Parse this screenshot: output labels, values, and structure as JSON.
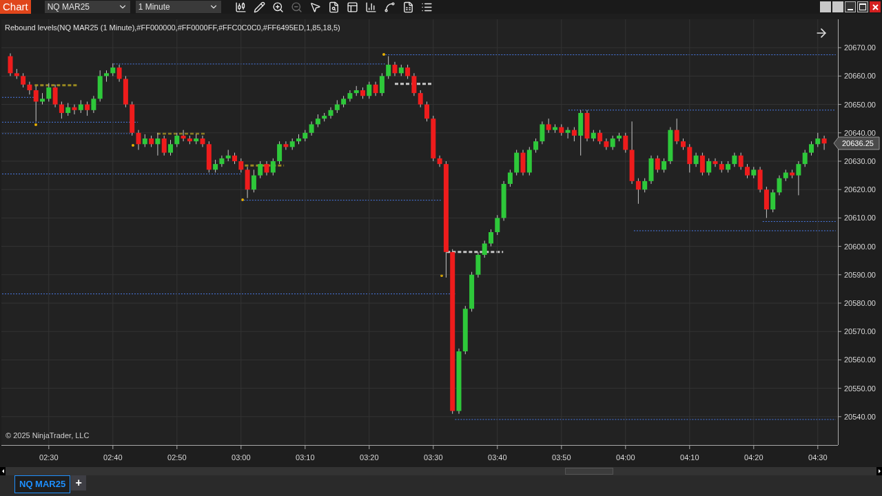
{
  "toolbar": {
    "title_tab": "Chart",
    "instrument": "NQ MAR25",
    "interval": "1 Minute"
  },
  "chart": {
    "indicator_label": "Rebound levels(NQ MAR25 (1 Minute),#FF000000,#FF0000FF,#FFC0C0C0,#FF6495ED,1,85,18,5)",
    "last_price": "20636.25",
    "chart_data": {
      "type": "candlestick",
      "grid": true,
      "categories": [
        null,
        null,
        null,
        null,
        null,
        null,
        "02:30",
        null,
        null,
        null,
        null,
        null,
        null,
        null,
        null,
        null,
        "02:40",
        null,
        null,
        null,
        null,
        null,
        null,
        null,
        null,
        null,
        "02:50",
        null,
        null,
        null,
        null,
        null,
        null,
        null,
        null,
        null,
        "03:00",
        null,
        null,
        null,
        null,
        null,
        null,
        null,
        null,
        null,
        "03:10",
        null,
        null,
        null,
        null,
        null,
        null,
        null,
        null,
        null,
        "03:20",
        null,
        null,
        null,
        null,
        null,
        null,
        null,
        null,
        null,
        "03:30",
        null,
        null,
        null,
        null,
        null,
        null,
        null,
        null,
        null,
        "03:40",
        null,
        null,
        null,
        null,
        null,
        null,
        null,
        null,
        null,
        "03:50",
        null,
        null,
        null,
        null,
        null,
        null,
        null,
        null,
        null,
        "04:00",
        null,
        null,
        null,
        null,
        null,
        null,
        null,
        null,
        null,
        "04:10",
        null,
        null,
        null,
        null,
        null,
        null,
        null,
        null,
        null,
        "04:20",
        null,
        null,
        null,
        null,
        null,
        null,
        null,
        null,
        null,
        "04:30",
        null
      ],
      "ohlc": [
        [
          20667,
          20668,
          20660,
          20661
        ],
        [
          20661,
          20662.5,
          20659,
          20660
        ],
        [
          20660,
          20661,
          20656,
          20657
        ],
        [
          20657,
          20658,
          20653.5,
          20655
        ],
        [
          20655,
          20656.5,
          20644,
          20651
        ],
        [
          20651,
          20654,
          20650,
          20652
        ],
        [
          20652,
          20657.5,
          20651,
          20656
        ],
        [
          20656,
          20657,
          20649,
          20650
        ],
        [
          20650,
          20651,
          20645,
          20647
        ],
        [
          20647,
          20650.5,
          20646,
          20649
        ],
        [
          20649,
          20650,
          20646.5,
          20648
        ],
        [
          20648,
          20651.5,
          20647,
          20650
        ],
        [
          20650,
          20651,
          20646,
          20648
        ],
        [
          20648,
          20653,
          20647,
          20652
        ],
        [
          20652,
          20662,
          20651,
          20660
        ],
        [
          20660,
          20662,
          20658,
          20661
        ],
        [
          20661,
          20664.5,
          20660,
          20663
        ],
        [
          20663,
          20664,
          20658,
          20659
        ],
        [
          20659,
          20660,
          20649,
          20650
        ],
        [
          20650,
          20651,
          20639,
          20640
        ],
        [
          20640,
          20641,
          20634,
          20636
        ],
        [
          20636,
          20639.5,
          20635,
          20638
        ],
        [
          20638,
          20639,
          20635,
          20636
        ],
        [
          20636,
          20640,
          20632,
          20638
        ],
        [
          20638,
          20639,
          20632,
          20633
        ],
        [
          20633,
          20637.5,
          20632,
          20636
        ],
        [
          20636,
          20640,
          20635,
          20639
        ],
        [
          20639,
          20641,
          20637,
          20638
        ],
        [
          20638,
          20639,
          20636,
          20637
        ],
        [
          20637,
          20639.5,
          20636,
          20638
        ],
        [
          20638,
          20639,
          20635,
          20636
        ],
        [
          20636,
          20637,
          20626,
          20627
        ],
        [
          20627,
          20630.5,
          20626,
          20629
        ],
        [
          20629,
          20632,
          20628,
          20631
        ],
        [
          20631,
          20634,
          20630,
          20632
        ],
        [
          20632,
          20633,
          20629,
          20630
        ],
        [
          20630,
          20631,
          20626,
          20627
        ],
        [
          20627,
          20628,
          20617,
          20620
        ],
        [
          20620,
          20627,
          20619,
          20625
        ],
        [
          20625,
          20630,
          20624,
          20629
        ],
        [
          20629,
          20630,
          20625,
          20626
        ],
        [
          20626,
          20631,
          20625,
          20630
        ],
        [
          20630,
          20637,
          20629,
          20636
        ],
        [
          20636,
          20637,
          20634,
          20635
        ],
        [
          20635,
          20638,
          20634,
          20637
        ],
        [
          20637,
          20639.5,
          20636,
          20638
        ],
        [
          20638,
          20641,
          20637,
          20640
        ],
        [
          20640,
          20644,
          20639,
          20643
        ],
        [
          20643,
          20646.5,
          20642,
          20645
        ],
        [
          20645,
          20647,
          20644,
          20646
        ],
        [
          20646,
          20649,
          20645,
          20648
        ],
        [
          20648,
          20651.5,
          20647,
          20650
        ],
        [
          20650,
          20653,
          20649,
          20652
        ],
        [
          20652,
          20655,
          20651,
          20654
        ],
        [
          20654,
          20656.5,
          20653,
          20655
        ],
        [
          20655,
          20656,
          20652,
          20653
        ],
        [
          20653,
          20658,
          20652,
          20657
        ],
        [
          20657,
          20658,
          20653,
          20654
        ],
        [
          20654,
          20661,
          20653,
          20660
        ],
        [
          20660,
          20667,
          20659,
          20664
        ],
        [
          20664,
          20665,
          20660,
          20661
        ],
        [
          20661,
          20664,
          20660,
          20663
        ],
        [
          20663,
          20664,
          20659,
          20660
        ],
        [
          20660,
          20661,
          20653,
          20654
        ],
        [
          20654,
          20655,
          20649,
          20650
        ],
        [
          20650,
          20651,
          20644,
          20645
        ],
        [
          20645,
          20646,
          20630,
          20631
        ],
        [
          20631,
          20632,
          20628,
          20629
        ],
        [
          20629,
          20630,
          20589,
          20598
        ],
        [
          20598,
          20599,
          20541,
          20542
        ],
        [
          20542,
          20564,
          20541,
          20563
        ],
        [
          20563,
          20579,
          20562,
          20578
        ],
        [
          20578,
          20591,
          20577,
          20590
        ],
        [
          20590,
          20598,
          20589,
          20597
        ],
        [
          20597,
          20602,
          20596,
          20601
        ],
        [
          20601,
          20606,
          20600,
          20605
        ],
        [
          20605,
          20611,
          20604,
          20610
        ],
        [
          20610,
          20623,
          20609,
          20622
        ],
        [
          20622,
          20627,
          20621,
          20626
        ],
        [
          20626,
          20634,
          20625,
          20633
        ],
        [
          20633,
          20634,
          20625,
          20626
        ],
        [
          20626,
          20635,
          20625,
          20634
        ],
        [
          20634,
          20638,
          20633,
          20637
        ],
        [
          20637,
          20644,
          20636,
          20643
        ],
        [
          20643,
          20645,
          20640,
          20641
        ],
        [
          20641,
          20643,
          20640,
          20642
        ],
        [
          20642,
          20643,
          20639,
          20640
        ],
        [
          20640,
          20642,
          20638,
          20641
        ],
        [
          20641,
          20642,
          20637,
          20639
        ],
        [
          20639,
          20648,
          20632,
          20647
        ],
        [
          20647,
          20648,
          20637,
          20638
        ],
        [
          20638,
          20641,
          20637,
          20640
        ],
        [
          20640,
          20641,
          20636,
          20637
        ],
        [
          20637,
          20638,
          20634,
          20635
        ],
        [
          20635,
          20639,
          20634,
          20638
        ],
        [
          20638,
          20640,
          20637,
          20639
        ],
        [
          20639,
          20640,
          20633,
          20634
        ],
        [
          20634,
          20644,
          20622,
          20623
        ],
        [
          20623,
          20624,
          20615,
          20620
        ],
        [
          20620,
          20624,
          20619,
          20623
        ],
        [
          20623,
          20632,
          20622,
          20631
        ],
        [
          20631,
          20632,
          20626,
          20627
        ],
        [
          20627,
          20631,
          20626,
          20630
        ],
        [
          20630,
          20642,
          20629,
          20641
        ],
        [
          20641,
          20645,
          20636,
          20637
        ],
        [
          20637,
          20638,
          20634,
          20635
        ],
        [
          20635,
          20636,
          20626,
          20629
        ],
        [
          20629,
          20633,
          20628,
          20632
        ],
        [
          20632,
          20633,
          20625,
          20626
        ],
        [
          20626,
          20631,
          20625,
          20630
        ],
        [
          20630,
          20631,
          20628,
          20629
        ],
        [
          20629,
          20630,
          20626,
          20627
        ],
        [
          20627,
          20630,
          20626,
          20629
        ],
        [
          20629,
          20633,
          20628,
          20632
        ],
        [
          20632,
          20633,
          20627,
          20628
        ],
        [
          20628,
          20629,
          20624,
          20625
        ],
        [
          20625,
          20628,
          20624,
          20627
        ],
        [
          20627,
          20628,
          20619,
          20620
        ],
        [
          20620,
          20621,
          20610,
          20613
        ],
        [
          20613,
          20620,
          20612,
          20619
        ],
        [
          20619,
          20625,
          20618,
          20624
        ],
        [
          20624,
          20627,
          20623,
          20626
        ],
        [
          20626,
          20627,
          20624,
          20625
        ],
        [
          20625,
          20630,
          20618,
          20629
        ],
        [
          20629,
          20634,
          20628,
          20633
        ],
        [
          20633,
          20637,
          20632,
          20636
        ],
        [
          20636,
          20640,
          20635,
          20638
        ],
        [
          20638,
          20639,
          20634,
          20636.25
        ]
      ],
      "ylim": [
        20530,
        20680
      ],
      "yticks": [
        {
          "value": 20670,
          "label": "20670.00"
        },
        {
          "value": 20660,
          "label": "20660.00"
        },
        {
          "value": 20650,
          "label": "20650.00"
        },
        {
          "value": 20640,
          "label": "20640.00"
        },
        {
          "value": 20630,
          "label": "20630.00"
        },
        {
          "value": 20620,
          "label": "20620.00"
        },
        {
          "value": 20610,
          "label": "20610.00"
        },
        {
          "value": 20600,
          "label": "20600.00"
        },
        {
          "value": 20590,
          "label": "20590.00"
        },
        {
          "value": 20580,
          "label": "20580.00"
        },
        {
          "value": 20570,
          "label": "20570.00"
        },
        {
          "value": 20560,
          "label": "20560.00"
        },
        {
          "value": 20550,
          "label": "20550.00"
        },
        {
          "value": 20540,
          "label": "20540.00"
        }
      ]
    }
  },
  "copyright": "© 2025 NinjaTrader, LLC",
  "bottom_tabs": [
    {
      "label": "NQ MAR25",
      "selected": true
    }
  ],
  "add_tab": "+"
}
